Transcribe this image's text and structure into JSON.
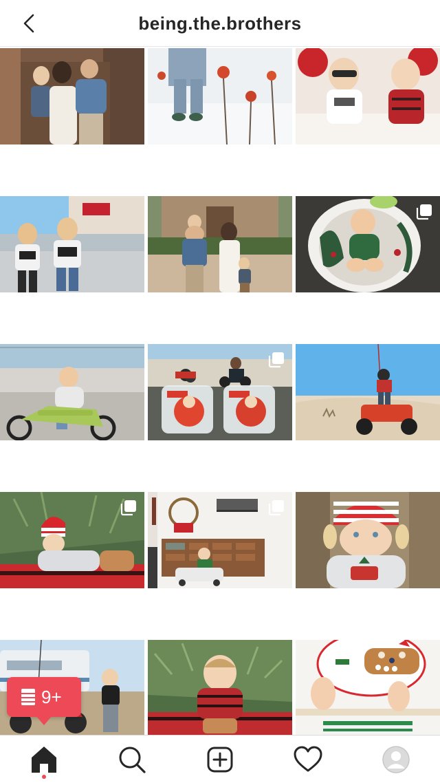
{
  "header": {
    "title": "being.the.brothers",
    "back_icon": "chevron-left-icon"
  },
  "grid": {
    "tiles": [
      {
        "desc": "family-doorway",
        "multi": false
      },
      {
        "desc": "snow-flowers",
        "multi": false
      },
      {
        "desc": "kids-balloons",
        "multi": false
      },
      {
        "desc": "brothers-walgreens",
        "multi": false
      },
      {
        "desc": "family-walking",
        "multi": false
      },
      {
        "desc": "baby-basket",
        "multi": true
      },
      {
        "desc": "balance-bike",
        "multi": false
      },
      {
        "desc": "elf-jars",
        "multi": true
      },
      {
        "desc": "atv-desert",
        "multi": false
      },
      {
        "desc": "striped-hat-lying",
        "multi": true
      },
      {
        "desc": "christmas-room",
        "multi": true
      },
      {
        "desc": "striped-hat-portrait",
        "multi": false
      },
      {
        "desc": "rv-dirtbike",
        "multi": false
      },
      {
        "desc": "plaid-toddler",
        "multi": false
      },
      {
        "desc": "cookie-plate",
        "multi": false
      }
    ]
  },
  "notification_badge": {
    "icon": "activity-list-icon",
    "label": "9+",
    "color": "#ed4956"
  },
  "tabbar": {
    "items": [
      {
        "name": "home",
        "icon": "home-icon",
        "active": true
      },
      {
        "name": "search",
        "icon": "search-icon",
        "active": false
      },
      {
        "name": "new-post",
        "icon": "plus-square-icon",
        "active": false
      },
      {
        "name": "activity",
        "icon": "heart-icon",
        "active": false
      },
      {
        "name": "profile",
        "icon": "avatar-icon",
        "active": false
      }
    ]
  },
  "colors": {
    "accent": "#ed4956",
    "text": "#262626",
    "divider": "#dbdbdb"
  }
}
